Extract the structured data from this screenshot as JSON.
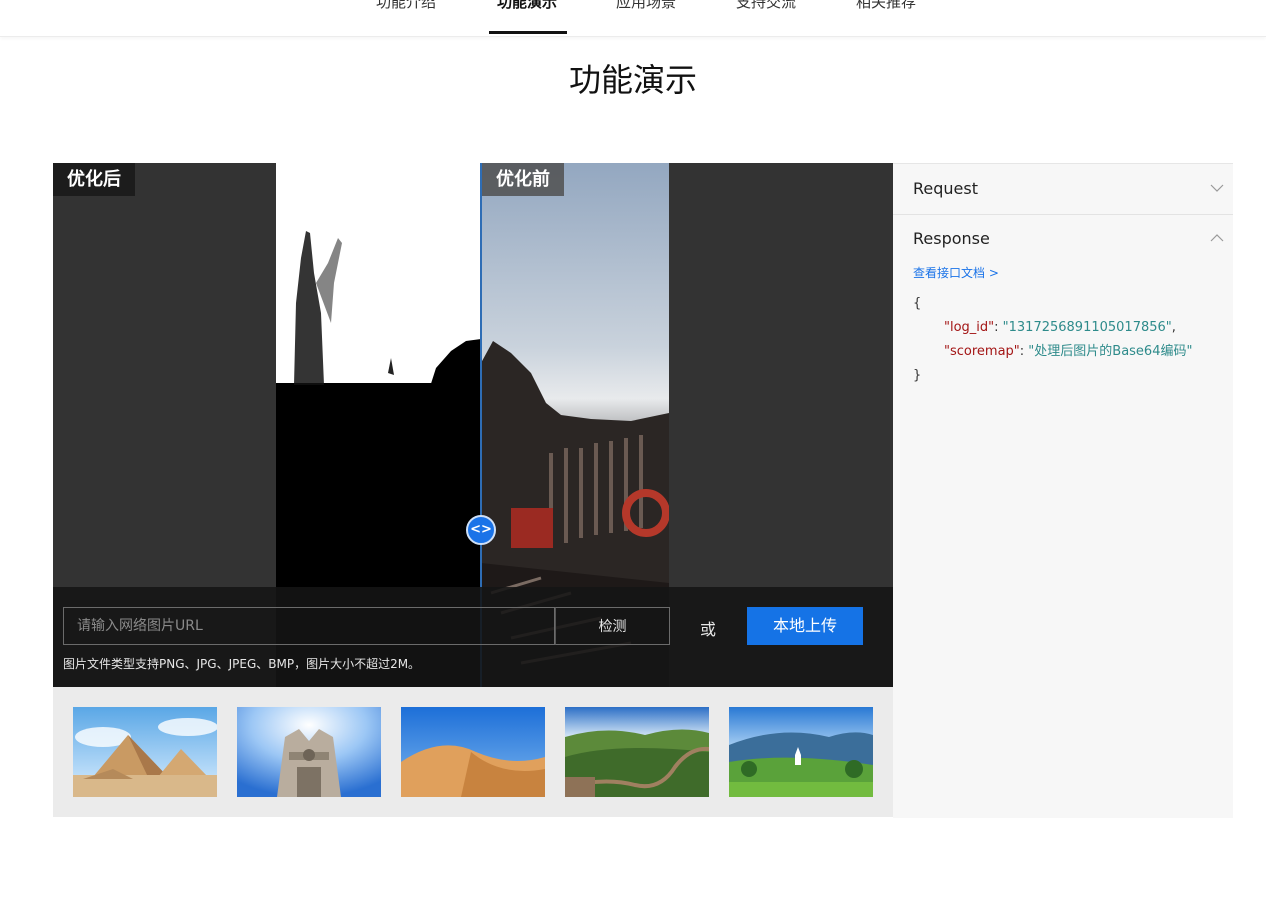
{
  "nav": {
    "tabs": [
      {
        "label": "功能介绍"
      },
      {
        "label": "功能演示",
        "active": true
      },
      {
        "label": "应用场景"
      },
      {
        "label": "支持交流"
      },
      {
        "label": "相关推荐"
      }
    ]
  },
  "page_title": "功能演示",
  "demo": {
    "after_label": "优化后",
    "before_label": "优化前",
    "slider_icon": "<>",
    "url_placeholder": "请输入网络图片URL",
    "detect_label": "检测",
    "or_label": "或",
    "upload_label": "本地上传",
    "hint": "图片文件类型支持PNG、JPG、JPEG、BMP，图片大小不超过2M。"
  },
  "thumbnails": [
    {
      "name": "pyramids"
    },
    {
      "name": "cathedral"
    },
    {
      "name": "desert-dunes"
    },
    {
      "name": "great-wall"
    },
    {
      "name": "valley-church"
    }
  ],
  "side_panel": {
    "request_label": "Request",
    "response_label": "Response",
    "doc_link": "查看接口文档 >",
    "json": {
      "open": "{",
      "close": "}",
      "k1": "\"log_id\"",
      "v1": "\"1317256891105017856\"",
      "k2": "\"scoremap\"",
      "v2": "\"处理后图片的Base64编码\""
    }
  },
  "colors": {
    "accent": "#1573e6",
    "demo_bg": "#333333",
    "json_key": "#a31515",
    "json_value": "#2e8b8b"
  }
}
